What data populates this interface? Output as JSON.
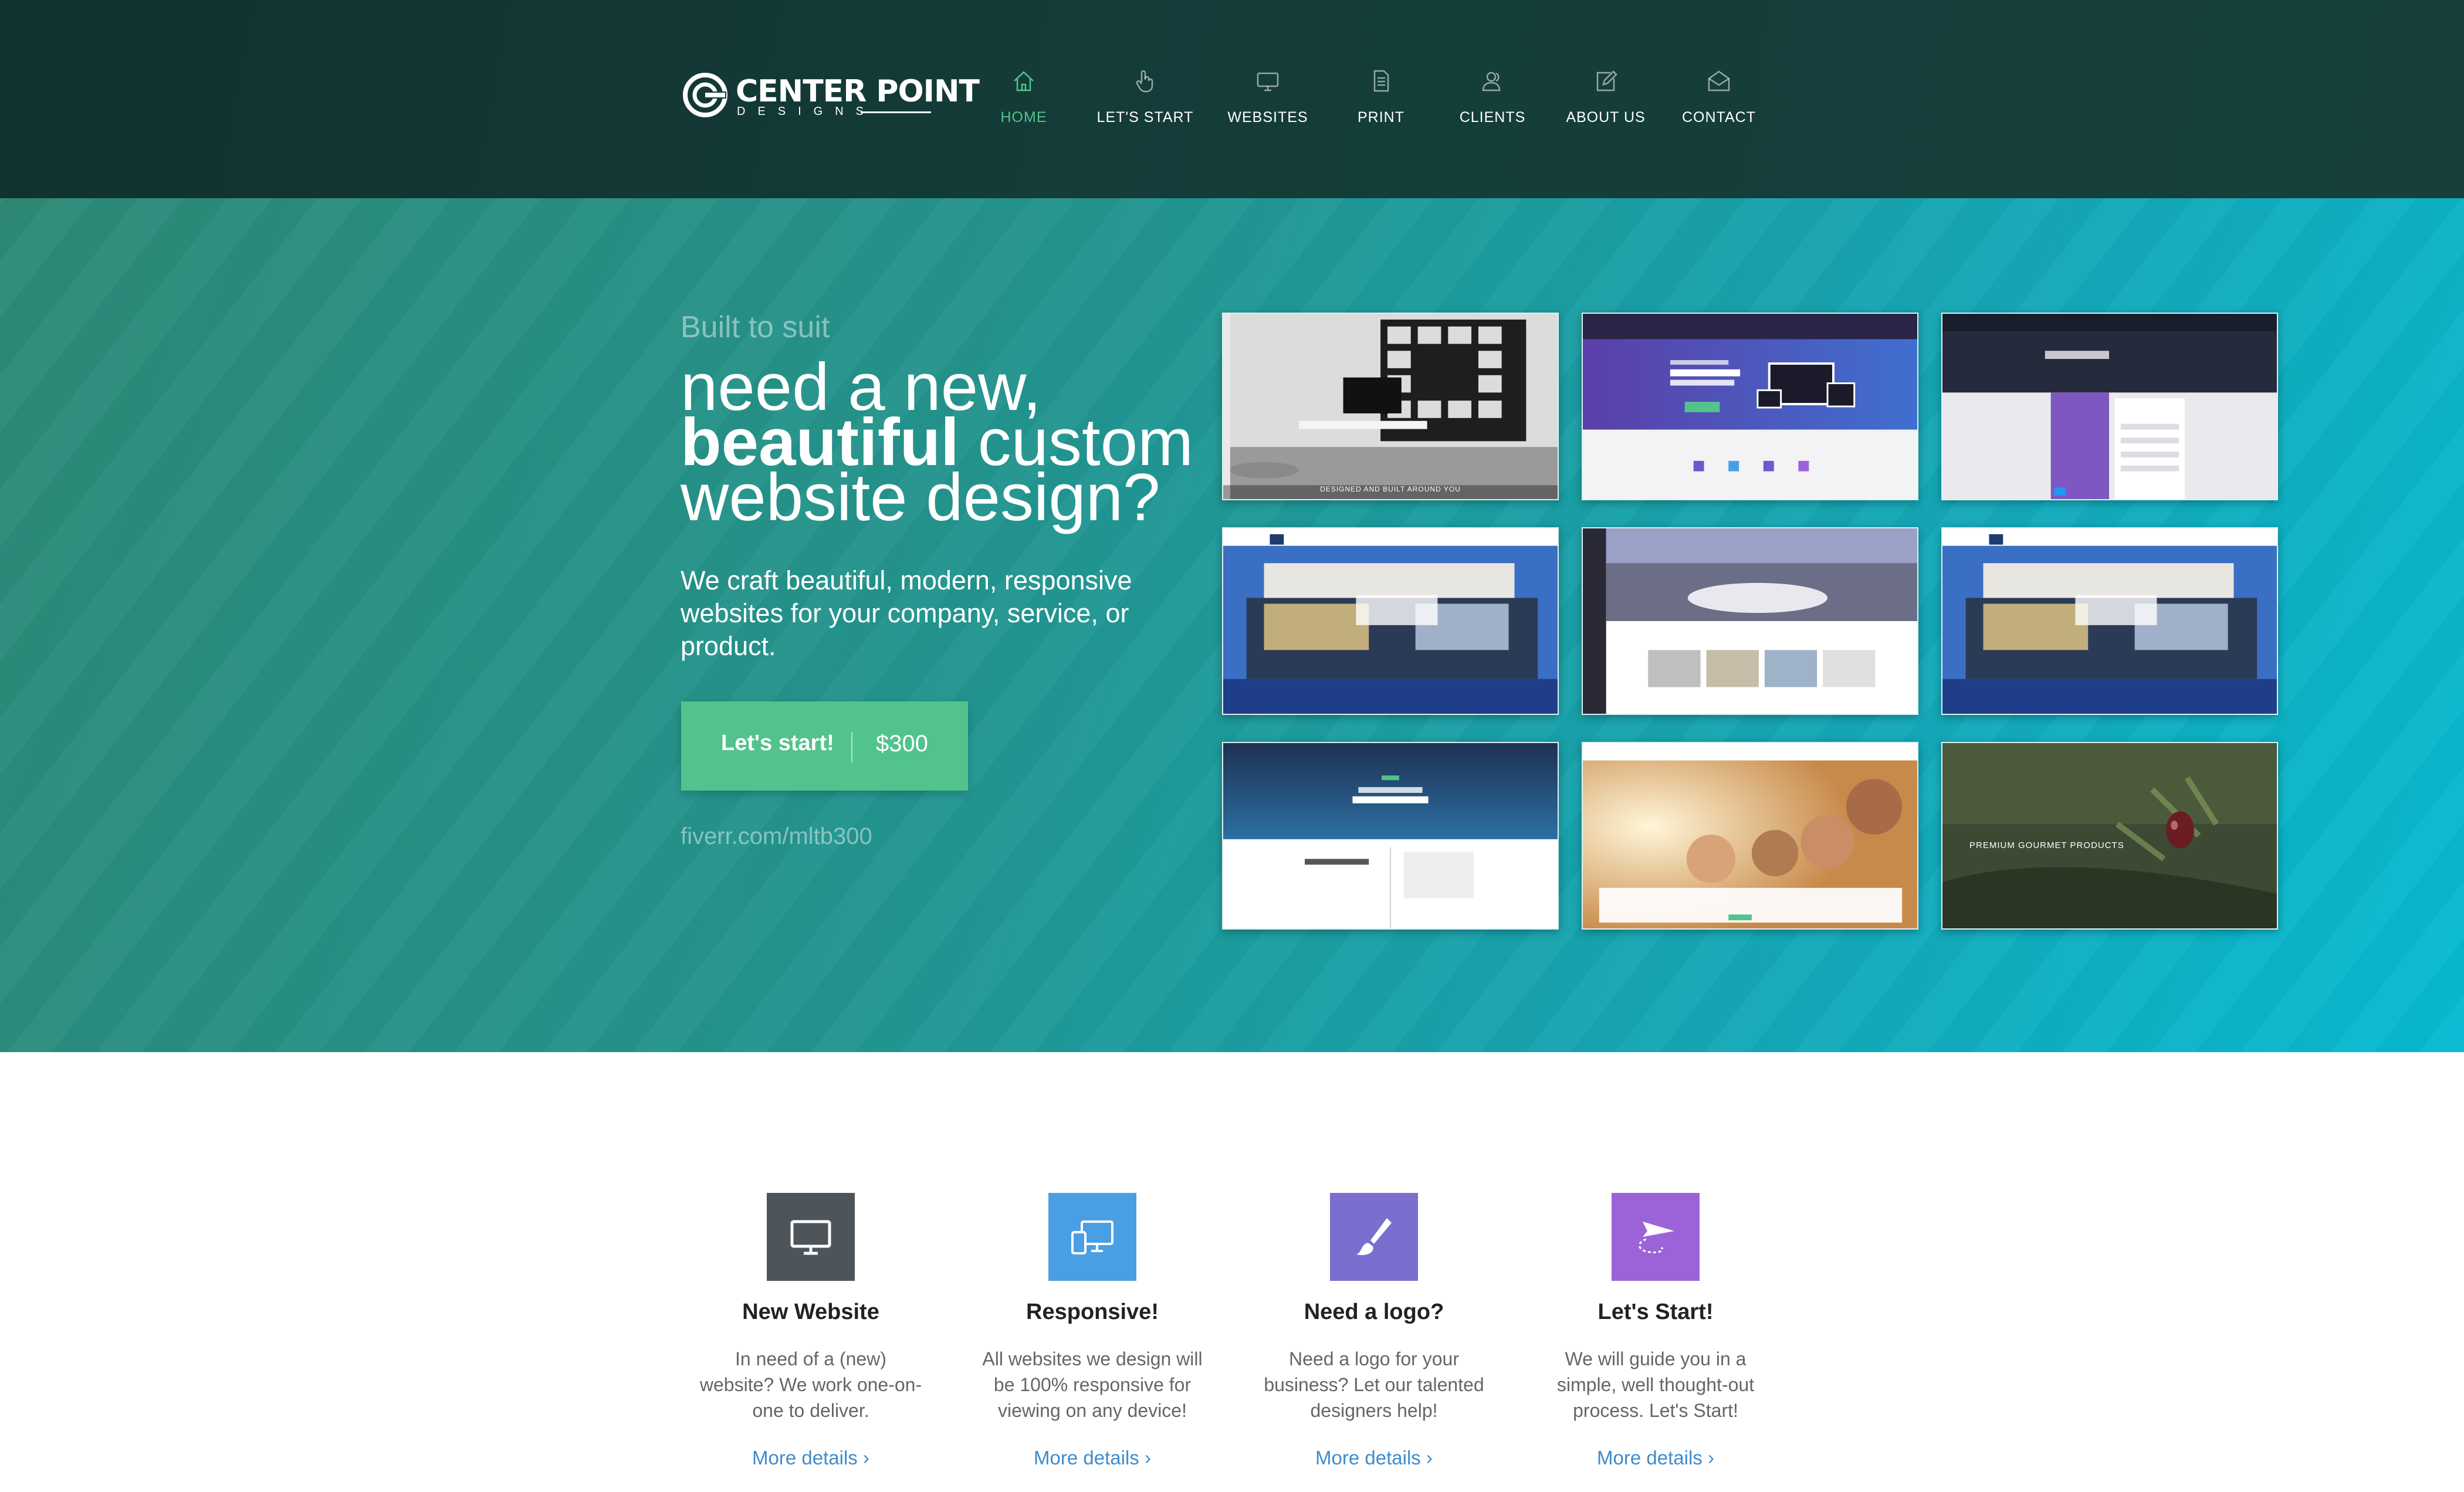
{
  "brand": {
    "name": "CENTER POINT",
    "tagline": "DESIGNS"
  },
  "nav": {
    "items": [
      {
        "label": "HOME",
        "icon": "home-icon",
        "active": true
      },
      {
        "label": "LET'S START",
        "icon": "hand-pointer-icon",
        "active": false
      },
      {
        "label": "WEBSITES",
        "icon": "monitor-icon",
        "active": false
      },
      {
        "label": "PRINT",
        "icon": "document-icon",
        "active": false
      },
      {
        "label": "CLIENTS",
        "icon": "users-icon",
        "active": false
      },
      {
        "label": "ABOUT US",
        "icon": "edit-icon",
        "active": false
      },
      {
        "label": "CONTACT",
        "icon": "mail-open-icon",
        "active": false
      }
    ]
  },
  "hero": {
    "eyebrow": "Built to suit",
    "headline": {
      "line1": "need a new,",
      "bold": "beautiful",
      "rest2": " custom",
      "line3": "website design?"
    },
    "subtext": "We  craft beautiful, modern, responsive websites for your company, service, or product.",
    "cta": {
      "label": "Let's start!",
      "price": "$300"
    },
    "fiverr": "fiverr.com/mltb300"
  },
  "portfolio": {
    "thumb1_caption": "DESIGNED AND BUILT AROUND YOU",
    "thumb9_caption": "PREMIUM GOURMET PRODUCTS"
  },
  "features": [
    {
      "icon": "monitor-icon",
      "color": "#4d555b",
      "title": "New Website",
      "desc": "In need of a (new) website? We work one-on-one to deliver.",
      "link": "More details ›"
    },
    {
      "icon": "devices-icon",
      "color": "#4a9fe4",
      "title": "Responsive!",
      "desc": "All websites we design will be 100% responsive for viewing on any device!",
      "link": "More details ›"
    },
    {
      "icon": "paintbrush-icon",
      "color": "#7a6fce",
      "title": "Need a logo?",
      "desc": "Need a logo for your business? Let our talented designers help!",
      "link": "More details ›"
    },
    {
      "icon": "paper-plane-icon",
      "color": "#9c63d9",
      "title": "Let's Start!",
      "desc": "We will guide you in a simple, well thought-out process. Let's Start!",
      "link": "More details ›"
    }
  ],
  "colors": {
    "accent_green": "#52c38c",
    "link_blue": "#3f8ccc",
    "header_bg": "#12322f"
  }
}
